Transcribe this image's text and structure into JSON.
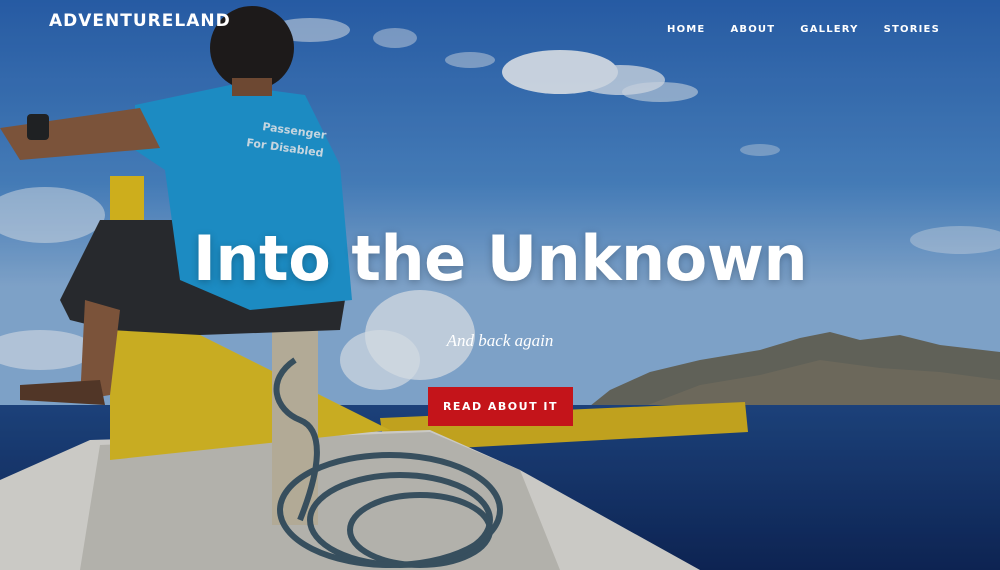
{
  "brand": {
    "name": "ADVENTURELAND"
  },
  "nav": {
    "items": [
      {
        "label": "HOME"
      },
      {
        "label": "ABOUT"
      },
      {
        "label": "GALLERY"
      },
      {
        "label": "STORIES"
      }
    ]
  },
  "hero": {
    "title": "Into the Unknown",
    "subtitle": "And back again",
    "cta_label": "READ ABOUT IT",
    "shirt_text_line1": "Passenger",
    "shirt_text_line2": "For Disabled"
  },
  "colors": {
    "cta_background": "#c4141a",
    "text": "#ffffff",
    "sky": "#4a86c8",
    "sea": "#14316a",
    "shirt": "#1e9ad6",
    "boat_yellow": "#e8c21a"
  }
}
